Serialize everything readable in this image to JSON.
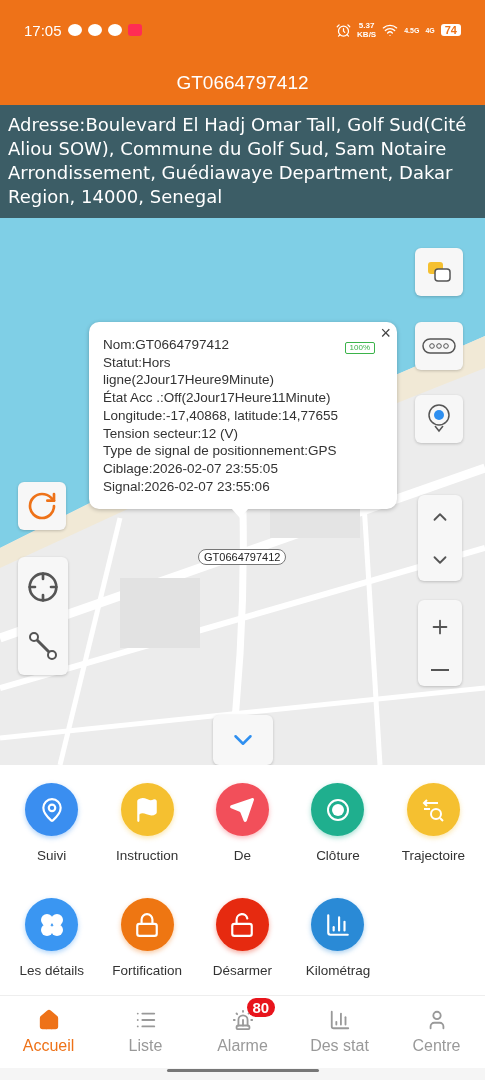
{
  "status_bar": {
    "time": "17:05",
    "speed_value": "5.37",
    "speed_unit": "KB/S",
    "network_1": "4.5G",
    "network_2": "4G",
    "battery": "74"
  },
  "title": "GT0664797412",
  "address": "Adresse:Boulevard El Hadj Omar Tall, Golf Sud(Cité Aliou SOW), Commune du Golf Sud, Sam Notaire Arrondissement, Guédiawaye Department, Dakar Region, 14000, Senegal",
  "map": {
    "device_label": "GT0664797412",
    "popup": {
      "close": "×",
      "battery": "100%",
      "lines": [
        "Nom:GT0664797412",
        "Statut:Hors ligne(2Jour17Heure9Minute)",
        "État Acc .:Off(2Jour17Heure11Minute)",
        "Longitude:-17,40868, latitude:14,77655",
        "Tension secteur:12 (V)",
        "Type de signal de positionnement:GPS",
        "Ciblage:2026-02-07 23:55:05",
        "Signal:2026-02-07 23:55:06"
      ]
    }
  },
  "actions": [
    {
      "kind": "pin",
      "label": "Suivi",
      "color": "#3a8ef0"
    },
    {
      "kind": "flag",
      "label": "Instruction",
      "color": "#f5c030"
    },
    {
      "kind": "send",
      "label": "De",
      "color": "#f24f5a"
    },
    {
      "kind": "fence",
      "label": "Clôture",
      "color": "#1faf8e"
    },
    {
      "kind": "route",
      "label": "Trajectoire",
      "color": "#f5c030"
    },
    {
      "kind": "grid",
      "label": "Les détails",
      "color": "#3a96f2"
    },
    {
      "kind": "lock",
      "label": "Fortification",
      "color": "#ee7612"
    },
    {
      "kind": "unlock",
      "label": "Désarmer",
      "color": "#e62a10"
    },
    {
      "kind": "chart",
      "label": "Kilométrag",
      "color": "#2a8ad6"
    }
  ],
  "tabs": [
    {
      "kind": "home",
      "label": "Accueil",
      "selected": true
    },
    {
      "kind": "list",
      "label": "Liste",
      "selected": false
    },
    {
      "kind": "alarm",
      "label": "Alarme",
      "selected": false,
      "badge": "80"
    },
    {
      "kind": "stats",
      "label": "Des stat",
      "selected": false
    },
    {
      "kind": "user",
      "label": "Centre",
      "selected": false
    }
  ]
}
